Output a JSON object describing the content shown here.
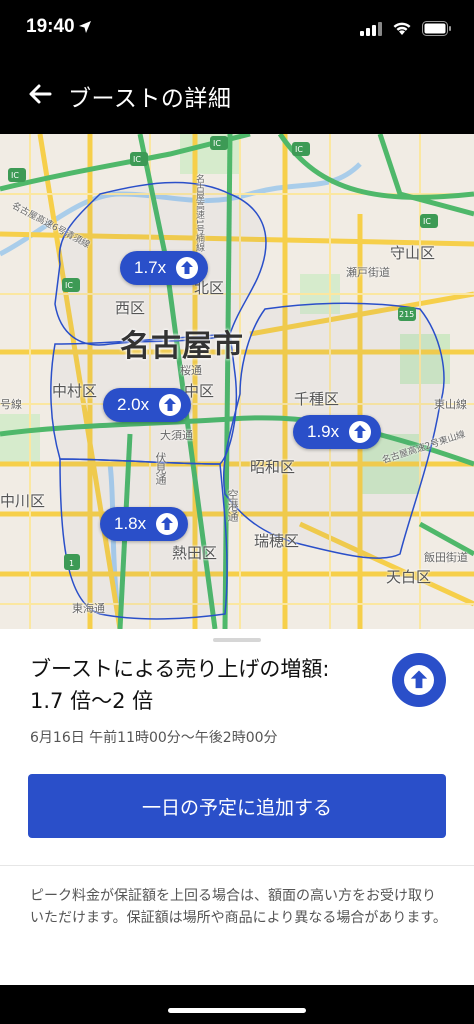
{
  "status_bar": {
    "time": "19:40"
  },
  "header": {
    "title": "ブーストの詳細"
  },
  "map": {
    "city": "名古屋市",
    "districts": [
      "北区",
      "西区",
      "中村区",
      "中区",
      "千種区",
      "守山区",
      "昭和区",
      "瑞穂区",
      "熱田区",
      "天白区",
      "中川区"
    ],
    "small_labels": [
      "IC",
      "IC",
      "IC",
      "IC",
      "IC",
      "IC",
      "215",
      "1",
      "桜通",
      "大須通",
      "伏見通",
      "空港通",
      "瀬戸街道",
      "東山線",
      "東海通",
      "飯田街道",
      "名古屋高速2号東山線",
      "名古屋高速6号清須線",
      "名古屋高速1号楠線",
      "号線"
    ],
    "boost_pins": [
      {
        "label": "1.7x"
      },
      {
        "label": "2.0x"
      },
      {
        "label": "1.9x"
      },
      {
        "label": "1.8x"
      }
    ]
  },
  "sheet": {
    "title_line1": "ブーストによる売り上げの増額:",
    "title_line2": "1.7 倍〜2 倍",
    "time_range": "6月16日 午前11時00分〜午後2時00分",
    "add_button": "一日の予定に追加する",
    "note": "ピーク料金が保証額を上回る場合は、額面の高い方をお受け取りいただけます。保証額は場所や商品により異なる場合があります。"
  },
  "colors": {
    "accent": "#2a4fc9",
    "boost_zone": "#2a4fc9"
  }
}
